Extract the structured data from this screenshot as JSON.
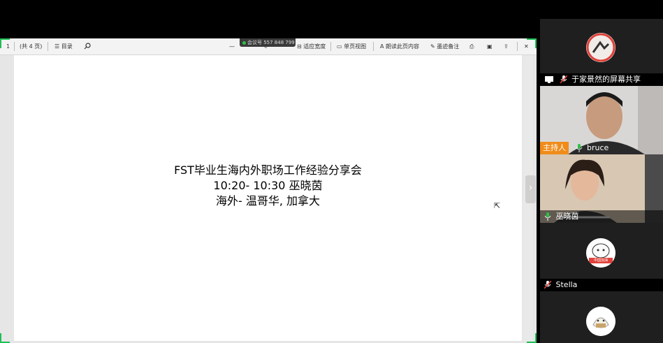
{
  "toolbar": {
    "page": "1",
    "page_total": "(共 4 页)",
    "toc_label": "目录",
    "meeting_id": "会议号 557 848 799",
    "adapt_width": "适应宽度",
    "single_page": "单页视图",
    "read_aloud": "朗读此页内容",
    "annotate": "墨迹备注"
  },
  "slide": {
    "line1": "FST毕业生海内外职场工作经验分享会",
    "line2": "10:20- 10:30  巫晓茵",
    "line3": "海外- 温哥华, 加拿大"
  },
  "participants": {
    "share_label": "于家景然的屏幕共享",
    "host_badge": "主持人",
    "bruce": "bruce",
    "speaker": "巫晓茵",
    "stella": "Stella",
    "stella_avatar_text": "中国加油"
  },
  "colors": {
    "accent_green": "#1fbf57",
    "host_orange": "#f08c1a",
    "muted_red": "#e0413a"
  }
}
